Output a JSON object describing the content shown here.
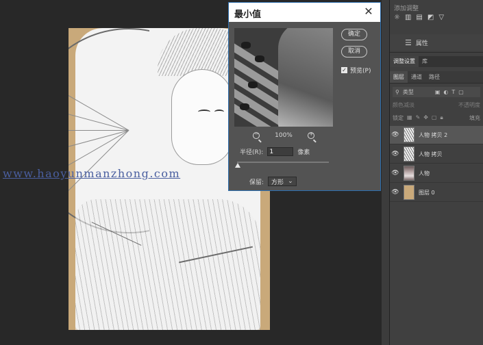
{
  "canvas": {
    "background_color": "#c9a97a",
    "watermark": "www.haoyunmanzhong.com"
  },
  "dialog": {
    "title": "最小值",
    "close_icon": "close-icon",
    "ok_label": "确定",
    "cancel_label": "取消",
    "preview_label": "预览(P)",
    "preview_checked": true,
    "zoom_level": "100%",
    "zoom_out_icon": "zoom-out-icon",
    "zoom_in_icon": "zoom-in-icon",
    "radius_label": "半径(R):",
    "radius_value": "1",
    "radius_unit": "像素",
    "preserve_label": "保留:",
    "preserve_value": "方形",
    "accent_color": "#2d6fb0"
  },
  "right_panel": {
    "adjustments_title": "添加调整",
    "adjustment_icons": [
      "☼",
      "▥",
      "▤",
      "◩",
      "▽"
    ],
    "properties_label": "属性",
    "top_tabs": [
      "调整设置",
      "库"
    ],
    "layer_tabs": [
      "图层",
      "通道",
      "路径"
    ],
    "filter_kind": "类型",
    "blend_mode": "颜色减淡",
    "opacity_label": "不透明度",
    "lock_label": "锁定",
    "fill_label": "填充",
    "layers": [
      {
        "name": "人物 拷贝 2",
        "thumb": "sketch",
        "selected": true
      },
      {
        "name": "人物 拷贝",
        "thumb": "sketch",
        "selected": false
      },
      {
        "name": "人物",
        "thumb": "photo",
        "selected": false
      },
      {
        "name": "图层 0",
        "thumb": "tan",
        "selected": false
      }
    ]
  }
}
